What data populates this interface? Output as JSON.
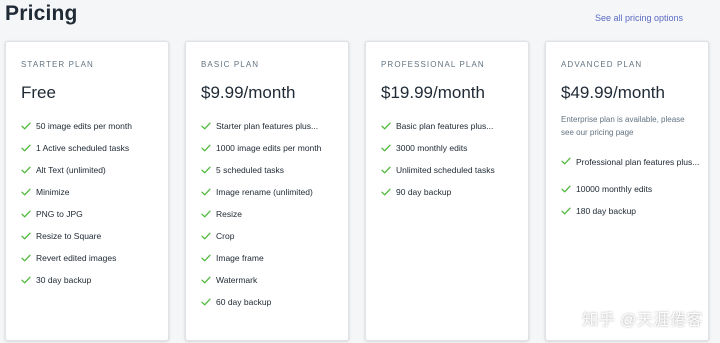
{
  "page": {
    "title": "Pricing",
    "see_all_link": "See all pricing options"
  },
  "plans": [
    {
      "name": "STARTER PLAN",
      "price": "Free",
      "note": "",
      "features": [
        "50 image edits per month",
        "1 Active scheduled tasks",
        "Alt Text (unlimited)",
        "Minimize",
        "PNG to JPG",
        "Resize to Square",
        "Revert edited images",
        "30 day backup"
      ]
    },
    {
      "name": "BASIC PLAN",
      "price": "$9.99/month",
      "note": "",
      "features": [
        "Starter plan features plus...",
        "1000 image edits per month",
        "5 scheduled tasks",
        "Image rename (unlimited)",
        "Resize",
        "Crop",
        "Image frame",
        "Watermark",
        "60 day backup"
      ]
    },
    {
      "name": "PROFESSIONAL PLAN",
      "price": "$19.99/month",
      "note": "",
      "features": [
        "Basic plan features plus...",
        "3000 monthly edits",
        "Unlimited scheduled tasks",
        "90 day backup"
      ]
    },
    {
      "name": "ADVANCED PLAN",
      "price": "$49.99/month",
      "note": "Enterprise plan is available, please see our pricing page",
      "features": [
        "Professional plan features plus...",
        "10000 monthly edits",
        "180 day backup"
      ]
    }
  ],
  "watermark": "知乎 @天涯倦客",
  "icons": {
    "feature": "check-icon"
  },
  "colors": {
    "check": "#50b83c",
    "link": "#5c6ac4",
    "background": "#f4f6f8"
  }
}
